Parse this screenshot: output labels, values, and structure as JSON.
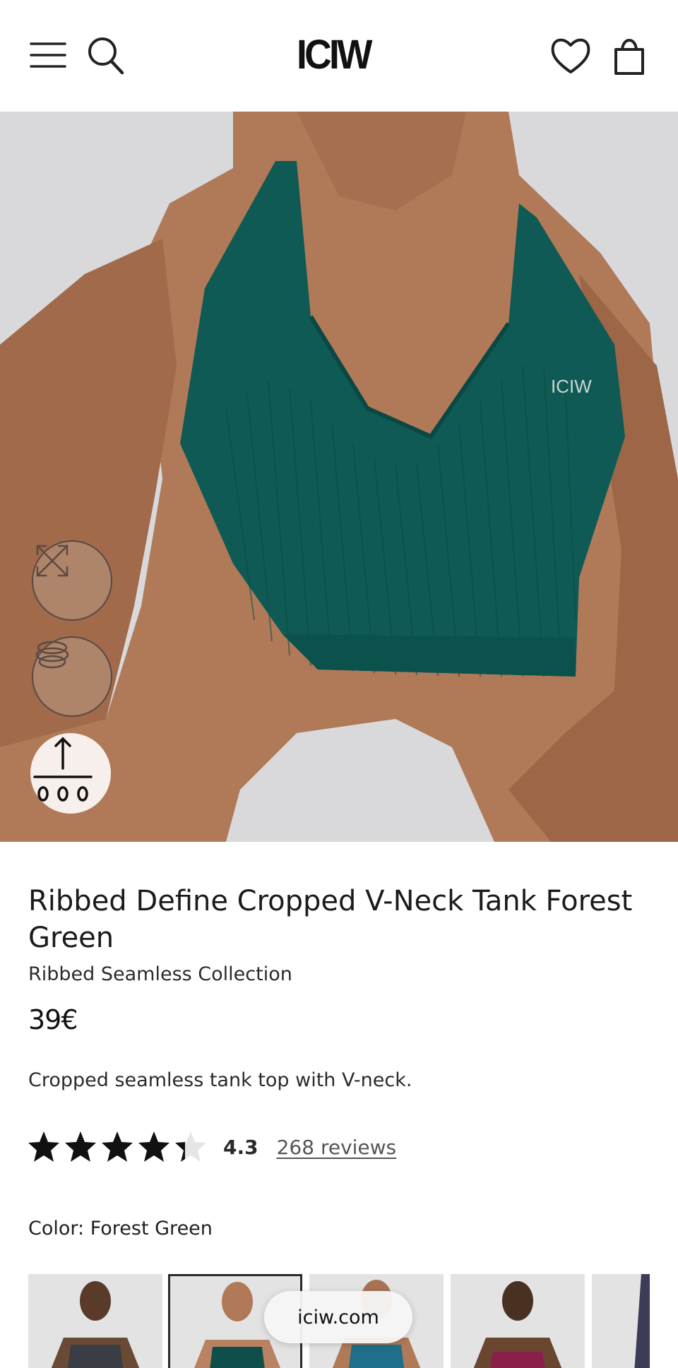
{
  "header": {
    "logo_text": "ICIW",
    "icons": [
      "menu-icon",
      "search-icon",
      "heart-icon",
      "bag-icon"
    ]
  },
  "hero": {
    "chest_logo": "ICIW",
    "buttons": [
      "expand-icon",
      "rotate-3d-icon",
      "size-guide-icon"
    ]
  },
  "product": {
    "title": "Ribbed Define Cropped V-Neck Tank Forest Green",
    "collection": "Ribbed Seamless Collection",
    "price": "39€",
    "description": "Cropped seamless tank top with V-neck.",
    "rating_value": "4.3",
    "rating_fraction": 0.86,
    "reviews_label": "268 reviews",
    "color_label": "Color: Forest Green"
  },
  "swatches": [
    {
      "color": "#3a3d44",
      "selected": false
    },
    {
      "color": "#0f4f4b",
      "selected": true
    },
    {
      "color": "#1f6f8a",
      "selected": false
    },
    {
      "color": "#8a1f4a",
      "selected": false
    },
    {
      "color": "#3a3d55",
      "selected": false
    }
  ],
  "browser": {
    "domain": "iciw.com"
  },
  "colors": {
    "tank_green": "#0f5a54",
    "skin": "#b07a58",
    "background": "#d9d9db"
  }
}
